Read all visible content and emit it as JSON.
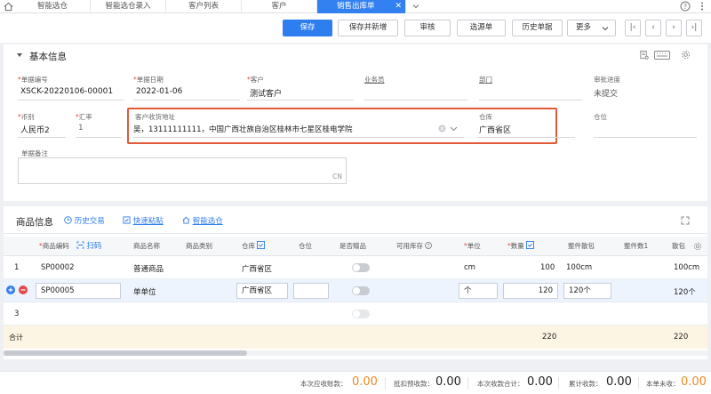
{
  "tabs": [
    {
      "label": "智能选仓"
    },
    {
      "label": "智能选仓录入"
    },
    {
      "label": "客户列表"
    },
    {
      "label": "客户"
    },
    {
      "label": "销售出库单"
    }
  ],
  "toolbar": {
    "save": "保存",
    "save_new": "保存并新增",
    "audit": "审核",
    "select_source": "选源单",
    "history": "历史单据",
    "more": "更多"
  },
  "basic": {
    "section_title": "基本信息",
    "fields": {
      "doc_no": {
        "label": "单据编号",
        "value": "XSCK-20220106-00001"
      },
      "doc_date": {
        "label": "单据日期",
        "value": "2022-01-06"
      },
      "customer": {
        "label": "客户",
        "value": "测试客户"
      },
      "salesman": {
        "label": "业务员",
        "value": ""
      },
      "dept": {
        "label": "部门",
        "value": ""
      },
      "approval": {
        "label": "审批进度",
        "value": "未提交"
      },
      "currency": {
        "label": "币别",
        "value": "人民币2"
      },
      "rate": {
        "label": "汇率",
        "value": "1"
      },
      "address": {
        "label": "客户收货地址",
        "value": "吴，13111111111，中国广西壮族自治区桂林市七星区桂电学院"
      },
      "warehouse": {
        "label": "仓库",
        "value": "广西省区"
      },
      "location": {
        "label": "仓位",
        "value": ""
      },
      "remark": {
        "label": "单据备注",
        "counter": "CN"
      }
    },
    "colors": {
      "highlight_border": "#e05a3a",
      "accent": "#2f7ef0"
    }
  },
  "goods": {
    "section_title": "商品信息",
    "actions": {
      "history": "历史交易",
      "paste": "快速粘贴",
      "smart": "智能选仓"
    },
    "scan": "扫码",
    "headers": {
      "code": "商品编码",
      "name": "商品名称",
      "category": "商品类别",
      "warehouse": "仓库",
      "location": "仓位",
      "gift": "是否赠品",
      "stock": "可用库存",
      "unit": "单位",
      "qty": "数量",
      "pack": "整件散包",
      "pack_count": "整件数1",
      "last": "散包"
    },
    "rows": [
      {
        "no": "1",
        "code": "SP00002",
        "name": "普通商品",
        "warehouse": "广西省区",
        "unit": "cm",
        "qty": "100",
        "pack": "100cm",
        "last": "100cm"
      },
      {
        "no": "",
        "code": "SP00005",
        "name": "单单位",
        "warehouse": "广西省区",
        "unit": "个",
        "qty": "120",
        "pack": "120个",
        "last": "120个"
      },
      {
        "no": "3",
        "code": "",
        "name": "",
        "warehouse": "",
        "unit": "",
        "qty": "",
        "pack": "",
        "last": ""
      }
    ],
    "total": {
      "label": "合计",
      "qty": "220",
      "last": "220"
    }
  },
  "summary": {
    "items": [
      {
        "label": "本次应收账款：",
        "value": "0.00"
      },
      {
        "label": "抵扣预收款：",
        "value": "0.00"
      },
      {
        "label": "本次收款合计：",
        "value": "0.00"
      },
      {
        "label": "累计收款：",
        "value": "0.00"
      },
      {
        "label": "本单未收：",
        "value": "0.00"
      }
    ],
    "colors": {
      "orange": "#f08a24",
      "dark": "#222222"
    }
  }
}
